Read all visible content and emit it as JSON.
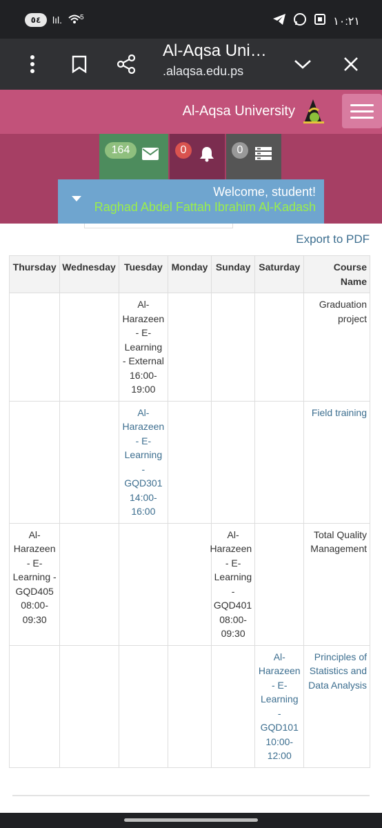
{
  "status_bar": {
    "time": "١٠:٢١",
    "left_pill": "٥٤",
    "signal_text": "lıl.",
    "wifi_badge": "5"
  },
  "browser": {
    "page_title": "Al-Aqsa Uni…",
    "url": ".alaqsa.edu.ps"
  },
  "site": {
    "brand": "Al-Aqsa University"
  },
  "notifications": {
    "messages": "164",
    "alerts": "0",
    "tasks": "0"
  },
  "welcome": {
    "greeting": "Welcome, student!",
    "student_name": "Raghad Abdel Fattah Ibrahim Al-Kadash"
  },
  "actions": {
    "export_pdf": "Export to PDF"
  },
  "schedule": {
    "headers": {
      "course": "Course Name",
      "saturday": "Saturday",
      "sunday": "Sunday",
      "monday": "Monday",
      "tuesday": "Tuesday",
      "wednesday": "Wednesday",
      "thursday": "Thursday"
    },
    "rows": [
      {
        "course": "Graduation project",
        "saturday": "",
        "sunday": "",
        "monday": "",
        "tuesday": "Al-Harazeen - E-Learning - External 16:00-19:00",
        "wednesday": "",
        "thursday": ""
      },
      {
        "course": "Field training",
        "saturday": "",
        "sunday": "",
        "monday": "",
        "tuesday": "Al-Harazeen - E-Learning - GQD301 14:00-16:00",
        "wednesday": "",
        "thursday": ""
      },
      {
        "course": "Total Quality Management",
        "saturday": "",
        "sunday": "Al-Harazeen - E-Learning - GQD401 08:00-09:30",
        "monday": "",
        "tuesday": "",
        "wednesday": "",
        "thursday": "Al-Harazeen - E-Learning - GQD405 08:00-09:30"
      },
      {
        "course": "Principles of Statistics and Data Analysis",
        "saturday": "Al-Harazeen - E-Learning - GQD101 10:00-12:00",
        "sunday": "",
        "monday": "",
        "tuesday": "",
        "wednesday": "",
        "thursday": ""
      }
    ]
  },
  "colors": {
    "header": "#c2527a",
    "band": "#a63f64",
    "mail_tile": "#4d8c5d",
    "bell_tile": "#7b2d4f",
    "tasks_tile": "#555555",
    "welcome_box": "#6fa5cf",
    "name_text": "#9bef4a",
    "link": "#3c6e8f"
  }
}
